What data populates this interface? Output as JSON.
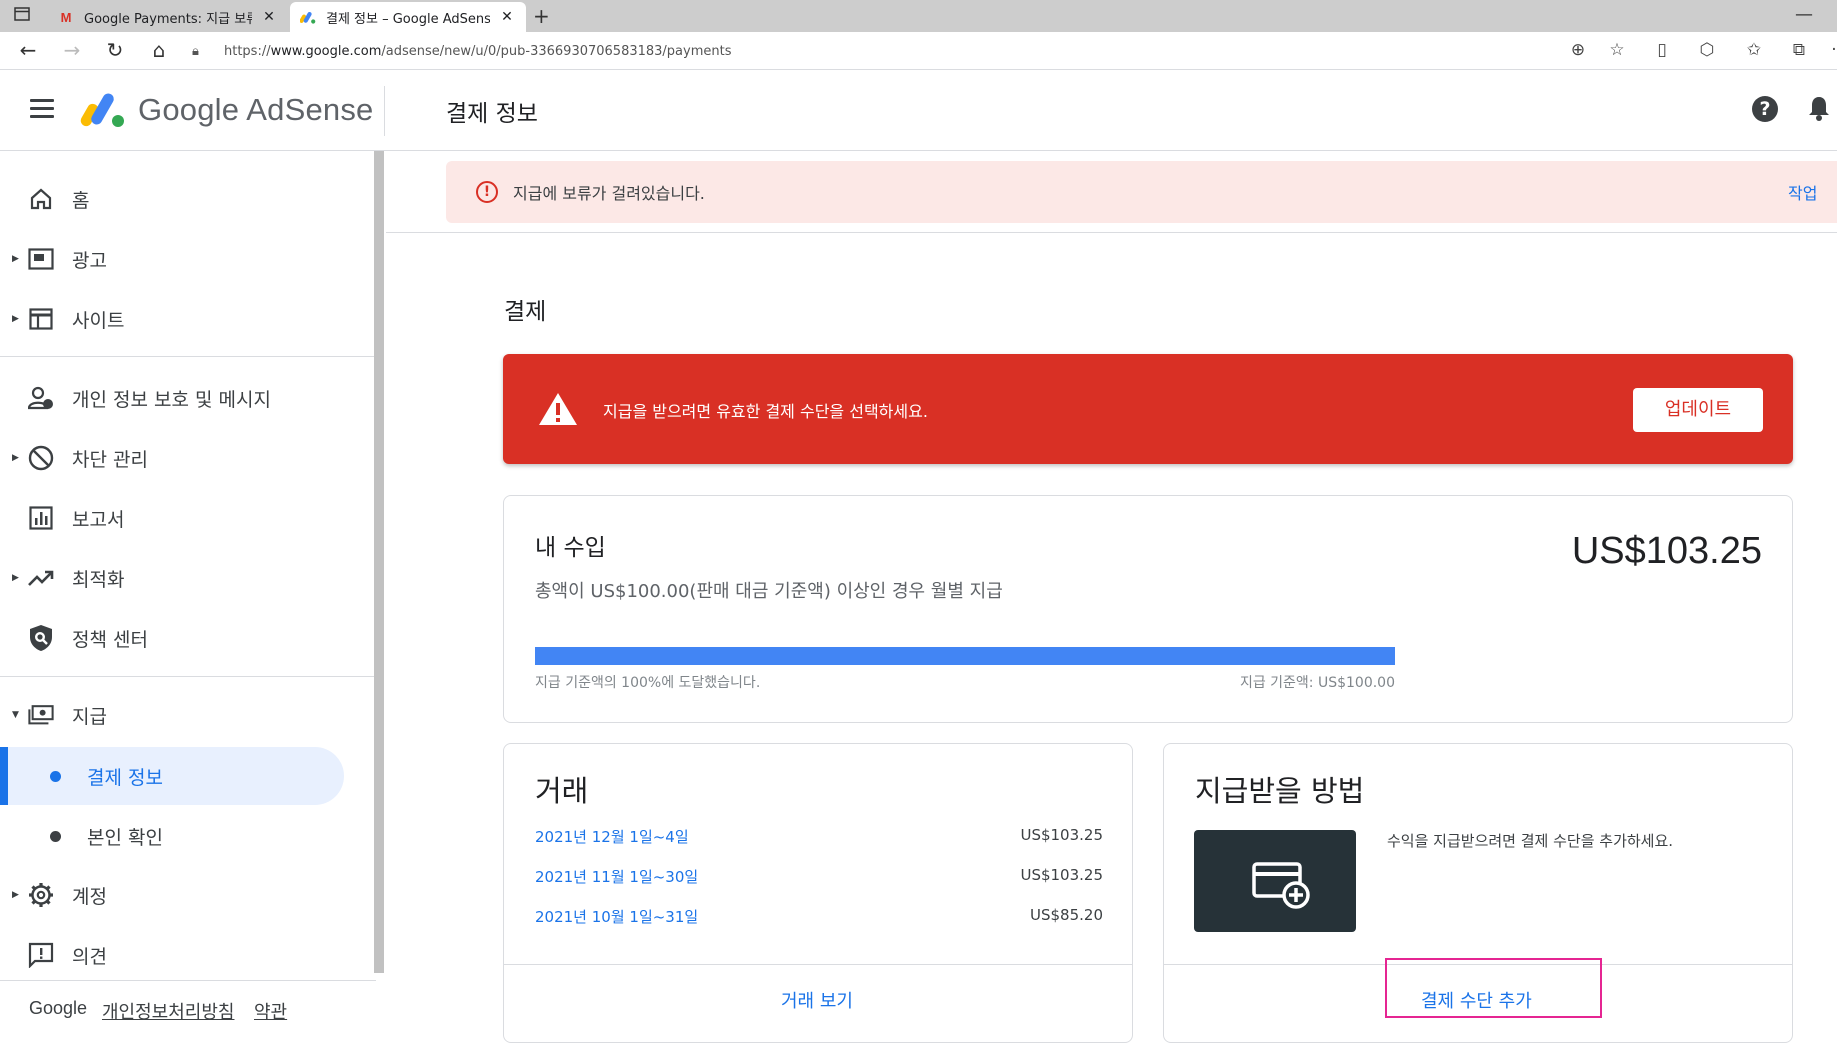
{
  "browser": {
    "tabs": [
      {
        "title": "Google Payments: 지급 보류 중 ·",
        "favicon": "gmail-icon",
        "active": false
      },
      {
        "title": "결제 정보 – Google AdSense",
        "favicon": "adsense-icon",
        "active": true
      }
    ],
    "url_prefix": "https://",
    "url_host": "www.google.com",
    "url_path": "/adsense/new/u/0/pub-3366930706583183/payments",
    "new_tab_symbol": "+",
    "minimize_symbol": "—"
  },
  "header": {
    "brand": "Google AdSense",
    "page_title": "결제 정보"
  },
  "sidebar": {
    "items": [
      {
        "label": "홈",
        "icon": "home-icon"
      },
      {
        "label": "광고",
        "icon": "ads-icon",
        "expandable": true
      },
      {
        "label": "사이트",
        "icon": "sites-icon",
        "expandable": true
      },
      {
        "label": "개인 정보 보호 및 메시지",
        "icon": "privacy-icon"
      },
      {
        "label": "차단 관리",
        "icon": "block-icon",
        "expandable": true
      },
      {
        "label": "보고서",
        "icon": "reports-icon"
      },
      {
        "label": "최적화",
        "icon": "optimization-icon",
        "expandable": true
      },
      {
        "label": "정책 센터",
        "icon": "policy-icon"
      },
      {
        "label": "지급",
        "icon": "payments-icon",
        "expanded": true
      },
      {
        "label": "계정",
        "icon": "gear-icon",
        "expandable": true
      },
      {
        "label": "의견",
        "icon": "feedback-icon"
      }
    ],
    "sub_items": [
      {
        "label": "결제 정보",
        "active": true
      },
      {
        "label": "본인 확인",
        "active": false
      }
    ],
    "footer": {
      "google": "Google",
      "privacy": "개인정보처리방침",
      "terms": "약관"
    }
  },
  "hold_banner": {
    "text": "지급에 보류가 걸려있습니다.",
    "action": "작업"
  },
  "main": {
    "section_title": "결제",
    "alert": {
      "text": "지급을 받으려면 유효한 결제 수단을 선택하세요.",
      "button": "업데이트"
    },
    "earnings": {
      "title": "내 수입",
      "description": "총액이 US$100.00(판매 대금 기준액) 이상인 경우 월별 지급",
      "amount": "US$103.25",
      "progress_fraction": 1.0,
      "progress_left": "지급 기준액의 100%에 도달했습니다.",
      "progress_right": "지급 기준액: US$100.00"
    },
    "transactions": {
      "title": "거래",
      "rows": [
        {
          "date": "2021년 12월 1일~4일",
          "amount": "US$103.25"
        },
        {
          "date": "2021년 11월 1일~30일",
          "amount": "US$103.25"
        },
        {
          "date": "2021년 10월 1일~31일",
          "amount": "US$85.20"
        }
      ],
      "link": "거래 보기"
    },
    "payment_method": {
      "title": "지급받을 방법",
      "description": "수익을 지급받으려면 결제 수단을 추가하세요.",
      "link": "결제 수단 추가"
    }
  },
  "colors": {
    "accent": "#1a73e8",
    "alert_red": "#d93025",
    "hold_bg": "#fce8e6",
    "progress": "#4285f4",
    "highlight": "#e52592"
  }
}
